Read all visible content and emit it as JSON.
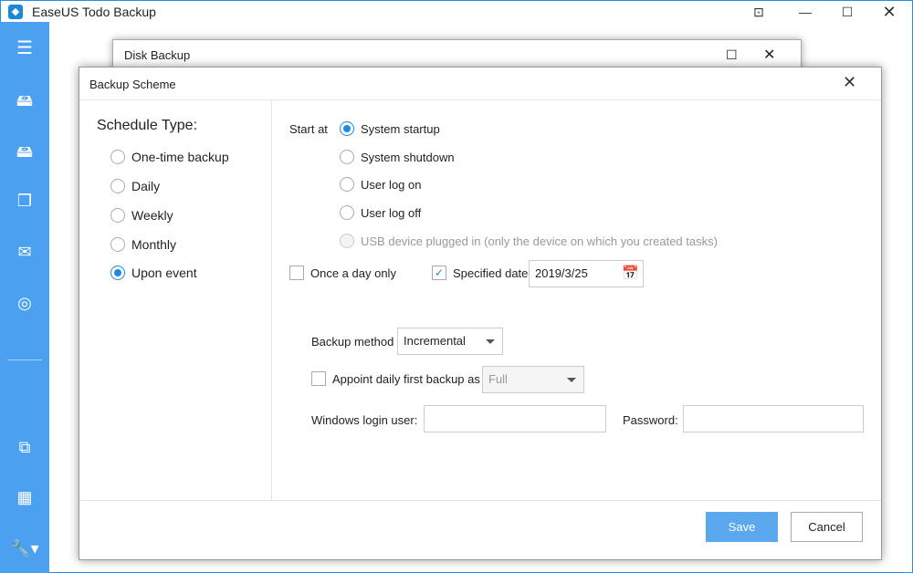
{
  "app": {
    "title": "EaseUS Todo Backup",
    "icon": "easeus-logo-icon",
    "window_buttons": [
      "dropdown-icon",
      "minimize-icon",
      "maximize-icon",
      "close-icon"
    ]
  },
  "sidebar": {
    "icons": [
      "menu-icon",
      "disk-backup-icon",
      "system-backup-icon",
      "file-backup-icon",
      "mail-backup-icon",
      "smart-backup-icon",
      "clone-icon",
      "apps-icon",
      "tools-icon"
    ]
  },
  "disk_window": {
    "title": "Disk Backup"
  },
  "dialog": {
    "title": "Backup Scheme",
    "schedule_label": "Schedule Type:",
    "schedule_types": [
      {
        "label": "One-time backup",
        "selected": false
      },
      {
        "label": "Daily",
        "selected": false
      },
      {
        "label": "Weekly",
        "selected": false
      },
      {
        "label": "Monthly",
        "selected": false
      },
      {
        "label": "Upon event",
        "selected": true
      }
    ],
    "start_at_label": "Start at",
    "events": [
      {
        "label": "System startup",
        "selected": true,
        "enabled": true
      },
      {
        "label": "System shutdown",
        "selected": false,
        "enabled": true
      },
      {
        "label": "User log on",
        "selected": false,
        "enabled": true
      },
      {
        "label": "User log off",
        "selected": false,
        "enabled": true
      },
      {
        "label": "USB device plugged in (only the device on which you created tasks)",
        "selected": false,
        "enabled": false
      }
    ],
    "once_a_day": {
      "label": "Once a day only",
      "checked": false
    },
    "specified_date": {
      "label": "Specified date",
      "checked": true,
      "value": "2019/3/25"
    },
    "backup_method": {
      "label": "Backup method",
      "value": "Incremental"
    },
    "appoint_first": {
      "label": "Appoint daily first backup as",
      "checked": false,
      "value": "Full"
    },
    "login_user": {
      "label": "Windows login user:",
      "value": ""
    },
    "password": {
      "label": "Password:",
      "value": ""
    },
    "save_label": "Save",
    "cancel_label": "Cancel"
  },
  "colors": {
    "accent": "#4ba1f0",
    "button": "#5ba8ef"
  }
}
